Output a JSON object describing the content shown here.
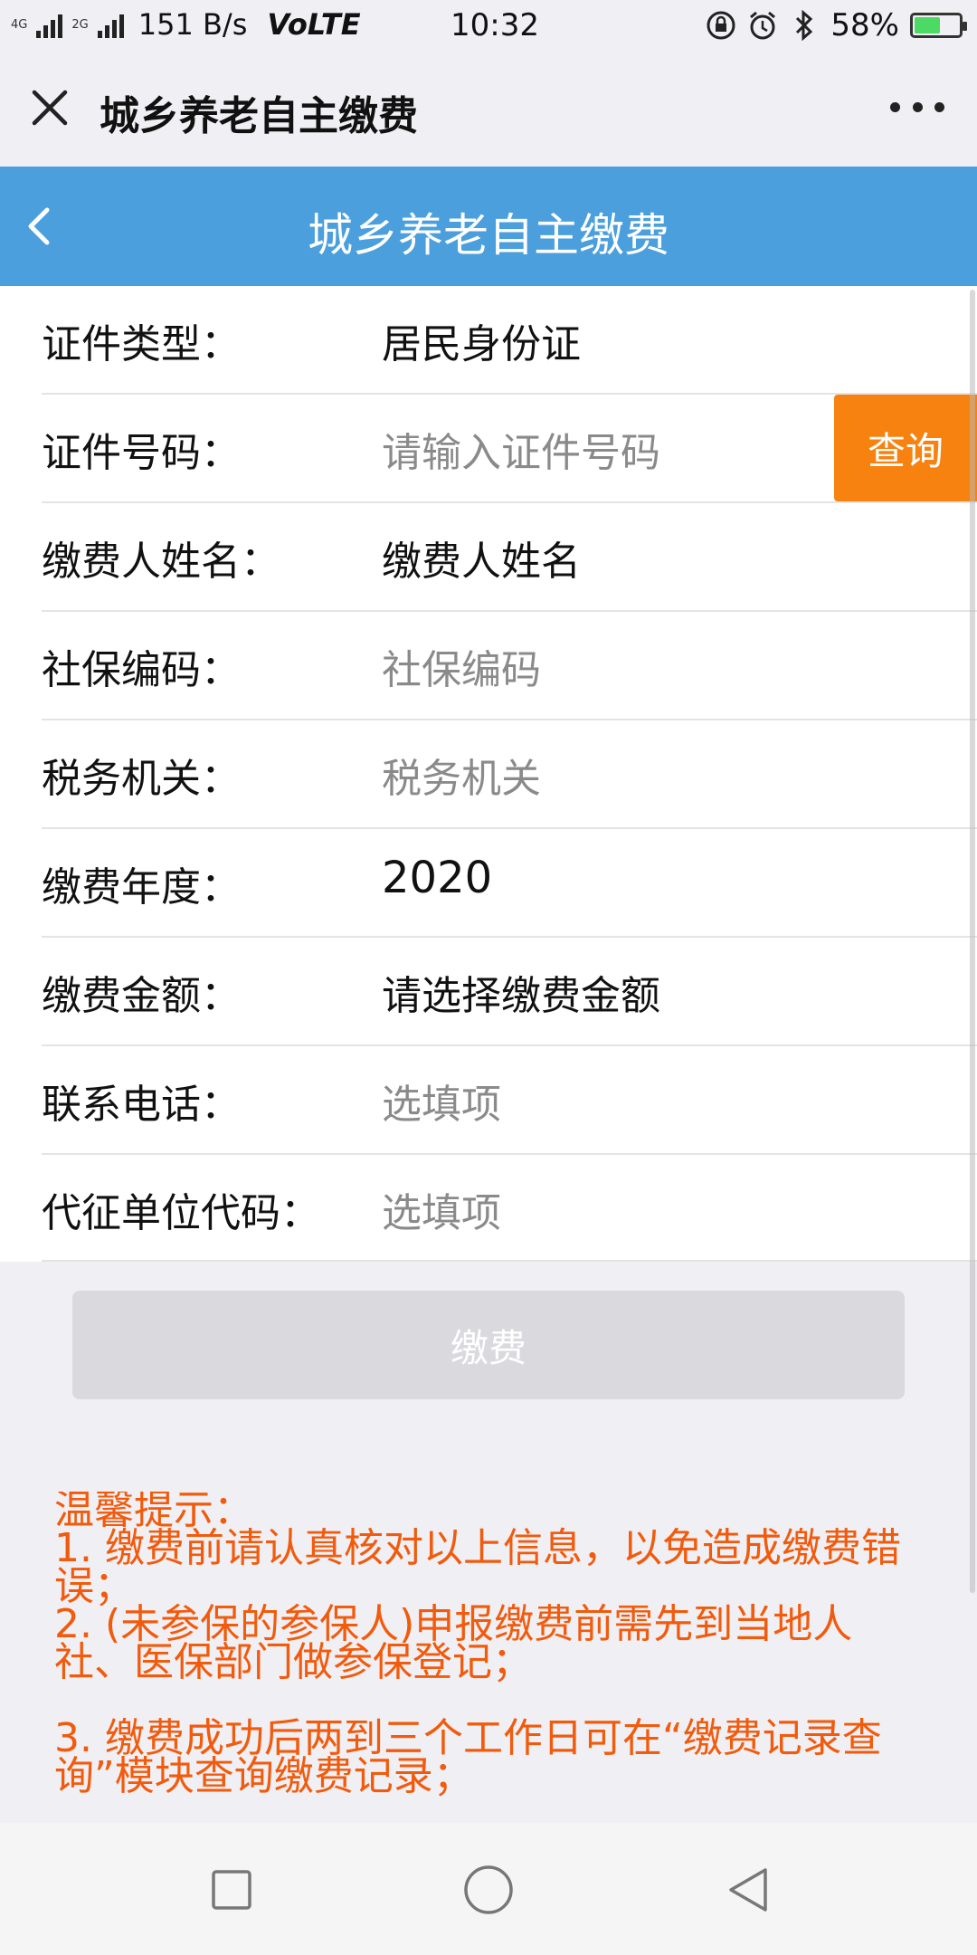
{
  "status_bar": {
    "net_top": "4G",
    "net_bottom": "2G",
    "speed": "151 B/s",
    "volte": "VoLTE",
    "time": "10:32",
    "battery_percent": "58%",
    "battery_level": 0.58,
    "icons": [
      "lock-rotation-icon",
      "alarm-icon",
      "bluetooth-icon",
      "battery-icon"
    ]
  },
  "titlebar": {
    "title": "城乡养老自主缴费"
  },
  "header": {
    "title": "城乡养老自主缴费"
  },
  "form": {
    "rows": [
      {
        "label": "证件类型：",
        "value": "居民身份证"
      },
      {
        "label": "证件号码：",
        "value": "请输入证件号码"
      },
      {
        "label": "缴费人姓名：",
        "value": "缴费人姓名"
      },
      {
        "label": "社保编码：",
        "value": "社保编码"
      },
      {
        "label": "税务机关：",
        "value": "税务机关"
      },
      {
        "label": "缴费年度：",
        "value": "2020"
      },
      {
        "label": "缴费金额：",
        "value": "请选择缴费金额"
      },
      {
        "label": "联系电话：",
        "value": "选填项"
      },
      {
        "label": "代征单位代码：",
        "value": "选填项"
      }
    ],
    "query_button": "查询"
  },
  "pay_button": "缴费",
  "tips": {
    "title": "温馨提示：",
    "item1": "1. 缴费前请认真核对以上信息，以免造成缴费错误；",
    "item2": "2. (未参保的参保人)申报缴费前需先到当地人社、医保部门做参保登记；",
    "item3": "3. 缴费成功后两到三个工作日可在“缴费记录查询”模块查询缴费记录；"
  },
  "colors": {
    "header_blue": "#4a9fdc",
    "query_orange": "#f7820f",
    "tips_orange": "#f25a0c",
    "disabled_button": "#d9d9de"
  }
}
